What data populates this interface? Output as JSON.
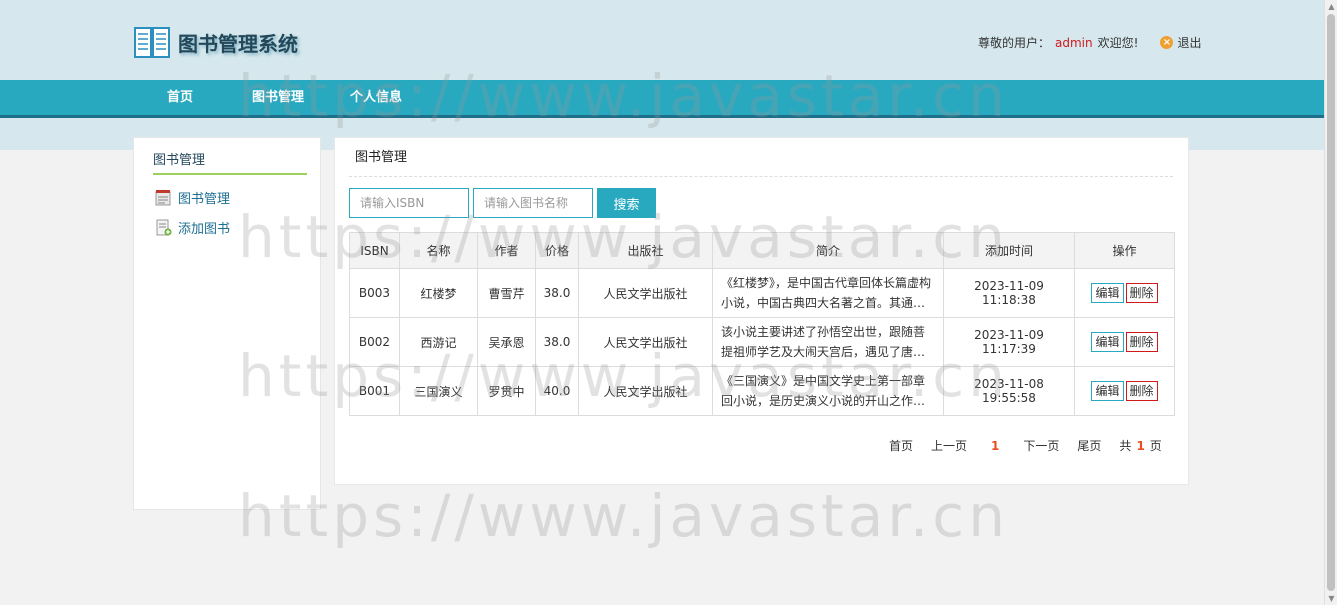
{
  "header": {
    "app_title": "图书管理系统",
    "greeting_prefix": "尊敬的用户：",
    "username": "admin",
    "greeting_suffix": "欢迎您!",
    "logout_label": "退出"
  },
  "nav": {
    "items": [
      {
        "label": "首页"
      },
      {
        "label": "图书管理"
      },
      {
        "label": "个人信息"
      }
    ]
  },
  "sidebar": {
    "title": "图书管理",
    "items": [
      {
        "label": "图书管理",
        "icon": "book-list-icon"
      },
      {
        "label": "添加图书",
        "icon": "add-book-icon"
      }
    ]
  },
  "main": {
    "title": "图书管理",
    "search": {
      "isbn_placeholder": "请输入ISBN",
      "name_placeholder": "请输入图书名称",
      "button_label": "搜索"
    },
    "table": {
      "headers": [
        "ISBN",
        "名称",
        "作者",
        "价格",
        "出版社",
        "简介",
        "添加时间",
        "操作"
      ],
      "rows": [
        {
          "isbn": "B003",
          "name": "红楼梦",
          "author": "曹雪芹",
          "price": "38.0",
          "publisher": "人民文学出版社",
          "desc": "《红楼梦》，是中国古代章回体长篇虚构小说，中国古典四大名著之首。其通行…",
          "added": "2023-11-09 11:18:38"
        },
        {
          "isbn": "B002",
          "name": "西游记",
          "author": "吴承恩",
          "price": "38.0",
          "publisher": "人民文学出版社",
          "desc": "该小说主要讲述了孙悟空出世，跟随菩提祖师学艺及大闹天宫后，遇见了唐僧、…",
          "added": "2023-11-09 11:17:39"
        },
        {
          "isbn": "B001",
          "name": "三国演义",
          "author": "罗贯中",
          "price": "40.0",
          "publisher": "人民文学出版社",
          "desc": "《三国演义》是中国文学史上第一部章回小说，是历史演义小说的开山之作，也…",
          "added": "2023-11-08 19:55:58"
        }
      ],
      "edit_label": "编辑",
      "delete_label": "删除"
    },
    "pagination": {
      "first": "首页",
      "prev": "上一页",
      "current": "1",
      "next": "下一页",
      "last": "尾页",
      "total_prefix": "共",
      "total_pages": "1",
      "total_suffix": "页"
    }
  },
  "watermark": "https://www.javastar.cn",
  "colors": {
    "accent": "#29a9c0",
    "header_bg": "#d6e8ee",
    "danger": "#d0191b",
    "pager_current": "#e8501e"
  }
}
